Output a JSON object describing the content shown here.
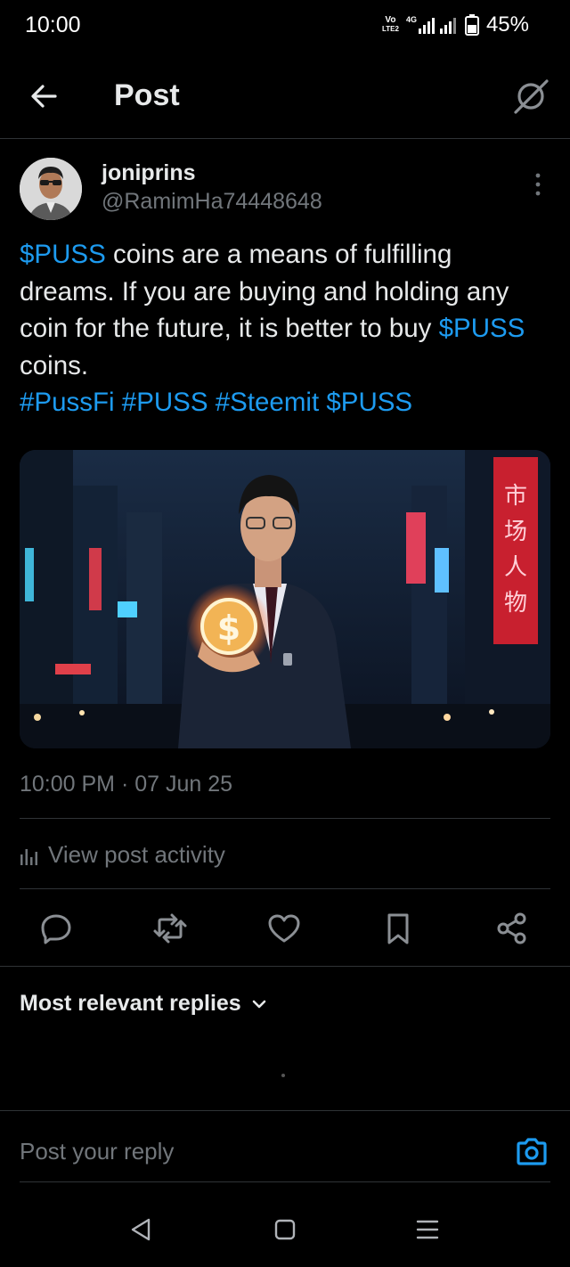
{
  "status_bar": {
    "time": "10:00",
    "volte_top": "Vo",
    "volte_bottom": "LTE2",
    "network": "4G",
    "battery": "45%"
  },
  "header": {
    "title": "Post",
    "back_icon": "arrow-left-icon",
    "grok_icon": "grok-icon"
  },
  "post": {
    "author": {
      "display_name": "joniprins",
      "handle": "@RamimHa74448648"
    },
    "text": {
      "p1_link": "$PUSS",
      "p1_rest": " coins are a means of fulfilling dreams. If you are buying and holding any coin for the future, it is better to buy ",
      "p2_link": "$PUSS",
      "p2_rest": " coins.",
      "hashtags": [
        "#PussFi",
        "#PUSS",
        "#Steemit",
        "$PUSS"
      ]
    },
    "timestamp": "10:00 PM · 07 Jun 25",
    "activity_label": "View post activity"
  },
  "actions": [
    "reply-icon",
    "retweet-icon",
    "heart-icon",
    "bookmark-icon",
    "share-icon"
  ],
  "replies": {
    "sort_label": "Most relevant replies"
  },
  "reply_box": {
    "placeholder": "Post your reply"
  },
  "colors": {
    "accent": "#1d9bf0",
    "muted": "#71767b",
    "text": "#e7e9ea",
    "divider": "#2f3336"
  }
}
